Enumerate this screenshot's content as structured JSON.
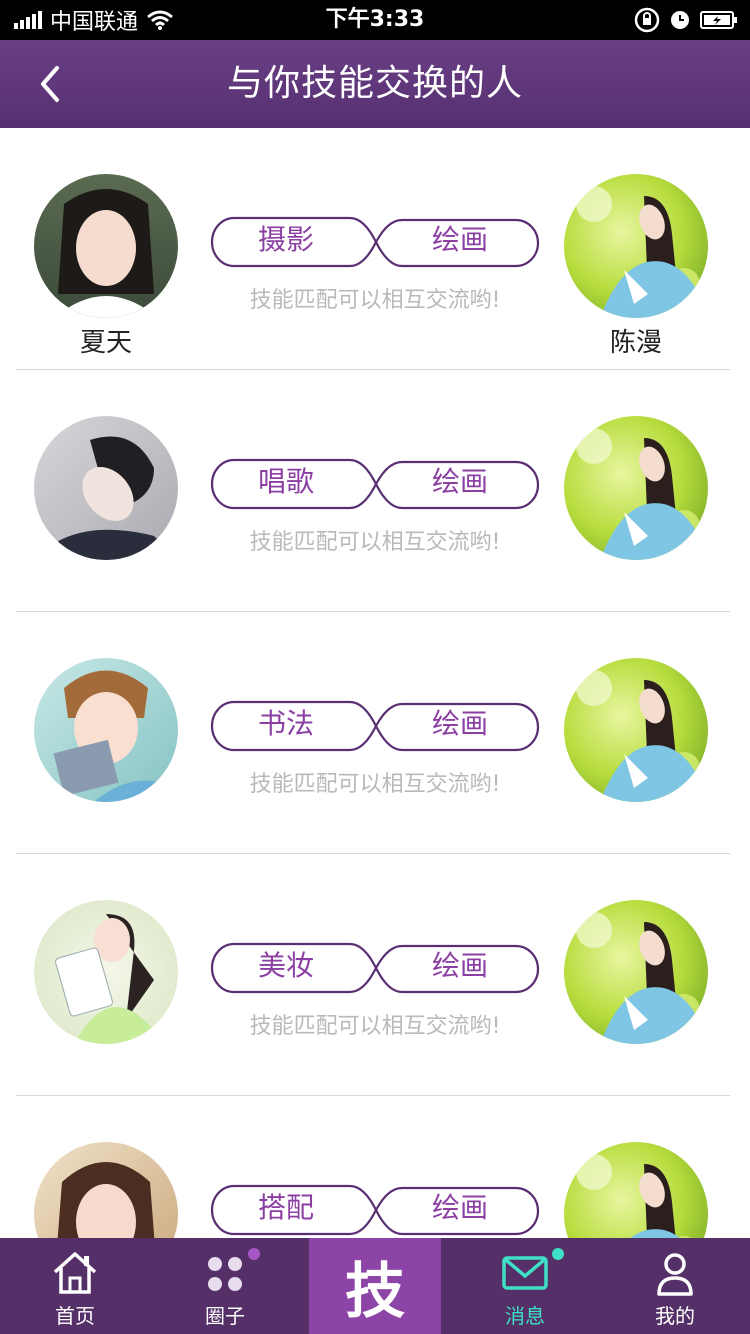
{
  "status_bar": {
    "carrier": "中国联通",
    "time": "下午3:33"
  },
  "header": {
    "title": "与你技能交换的人",
    "back_icon": "chevron-left-icon"
  },
  "rows": [
    {
      "left_name": "夏天",
      "right_name": "陈漫",
      "left_skill": "摄影",
      "right_skill": "绘画",
      "hint": "技能匹配可以相互交流哟!"
    },
    {
      "left_name": "",
      "right_name": "",
      "left_skill": "唱歌",
      "right_skill": "绘画",
      "hint": "技能匹配可以相互交流哟!"
    },
    {
      "left_name": "",
      "right_name": "",
      "left_skill": "书法",
      "right_skill": "绘画",
      "hint": "技能匹配可以相互交流哟!"
    },
    {
      "left_name": "",
      "right_name": "",
      "left_skill": "美妆",
      "right_skill": "绘画",
      "hint": "技能匹配可以相互交流哟!"
    },
    {
      "left_name": "",
      "right_name": "",
      "left_skill": "搭配",
      "right_skill": "绘画",
      "hint": ""
    }
  ],
  "nav": {
    "home": "首页",
    "circle": "圈子",
    "center_glyph": "技",
    "messages": "消息",
    "mine": "我的"
  },
  "colors": {
    "header": "#6b3f86",
    "nav_bg": "#552f68",
    "nav_center": "#8c45a6",
    "skill_text": "#8b3fa3",
    "active_tab": "#3ee0c6",
    "badge_purple": "#a855c8"
  }
}
